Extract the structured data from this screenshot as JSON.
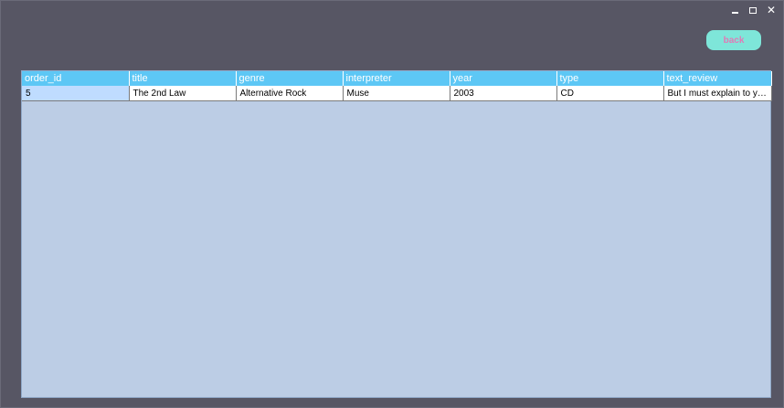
{
  "window": {
    "controls": {
      "minimize_glyph": "",
      "maximize_glyph": "",
      "close_glyph": "✕"
    }
  },
  "toolbar": {
    "back_label": "back"
  },
  "table": {
    "columns": [
      "order_id",
      "title",
      "genre",
      "interpreter",
      "year",
      "type",
      "text_review"
    ],
    "rows": [
      [
        "5",
        "The 2nd Law",
        "Alternative Rock",
        "Muse",
        "2003",
        "CD",
        "But I must explain to yo..."
      ]
    ]
  },
  "colors": {
    "window_bg": "#575664",
    "header_bg": "#5dc7f5",
    "grid_bg": "#bccde5",
    "back_button_bg": "#7ee6d9",
    "back_button_text": "#e07ab6",
    "selected_cell": "#bfdcff"
  }
}
